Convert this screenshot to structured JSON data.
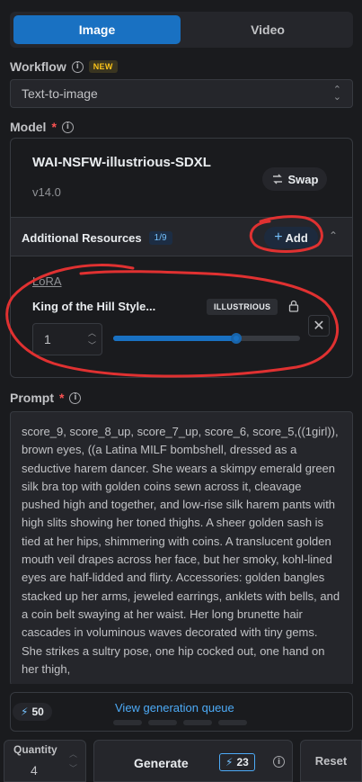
{
  "tabs": [
    {
      "label": "Image",
      "active": true
    },
    {
      "label": "Video",
      "active": false
    }
  ],
  "workflow": {
    "label": "Workflow",
    "badge": "NEW",
    "value": "Text-to-image"
  },
  "model": {
    "label": "Model",
    "required_mark": "*",
    "name": "WAI-NSFW-illustrious-SDXL",
    "version": "v14.0",
    "swap_label": "Swap"
  },
  "resources": {
    "title": "Additional Resources",
    "count": "1/9",
    "add_label": "Add",
    "lora": {
      "type_link": "LoRA",
      "name": "King of the Hill Style...",
      "base_badge": "ILLUSTRIOUS",
      "strength": "1",
      "slider_fraction": 0.66
    }
  },
  "prompt": {
    "label": "Prompt",
    "required_mark": "*",
    "text": "score_9, score_8_up, score_7_up, score_6, score_5,((1girl)), brown eyes, ((a Latina MILF bombshell, dressed as a seductive harem dancer. She wears a skimpy emerald green silk bra top with golden coins sewn across it, cleavage pushed high and together, and low-rise silk harem pants with high slits showing her toned thighs. A sheer golden sash is tied at her hips, shimmering with coins. A translucent golden mouth veil drapes across her face, but her smoky, kohl-lined eyes are half-lidded and flirty. Accessories: golden bangles stacked up her arms, jeweled earrings, anklets with bells, and a coin belt swaying at her waist. Her long brunette hair cascades in voluminous waves decorated with tiny gems. She strikes a sultry pose, one hip cocked out, one hand on her thigh,"
  },
  "queue": {
    "credits": "50",
    "link": "View generation queue"
  },
  "footer": {
    "quantity_label": "Quantity",
    "quantity_value": "4",
    "generate_label": "Generate",
    "generate_cost": "23",
    "reset_label": "Reset"
  },
  "colors": {
    "accent": "#1971c2",
    "annotation": "#e03131"
  }
}
